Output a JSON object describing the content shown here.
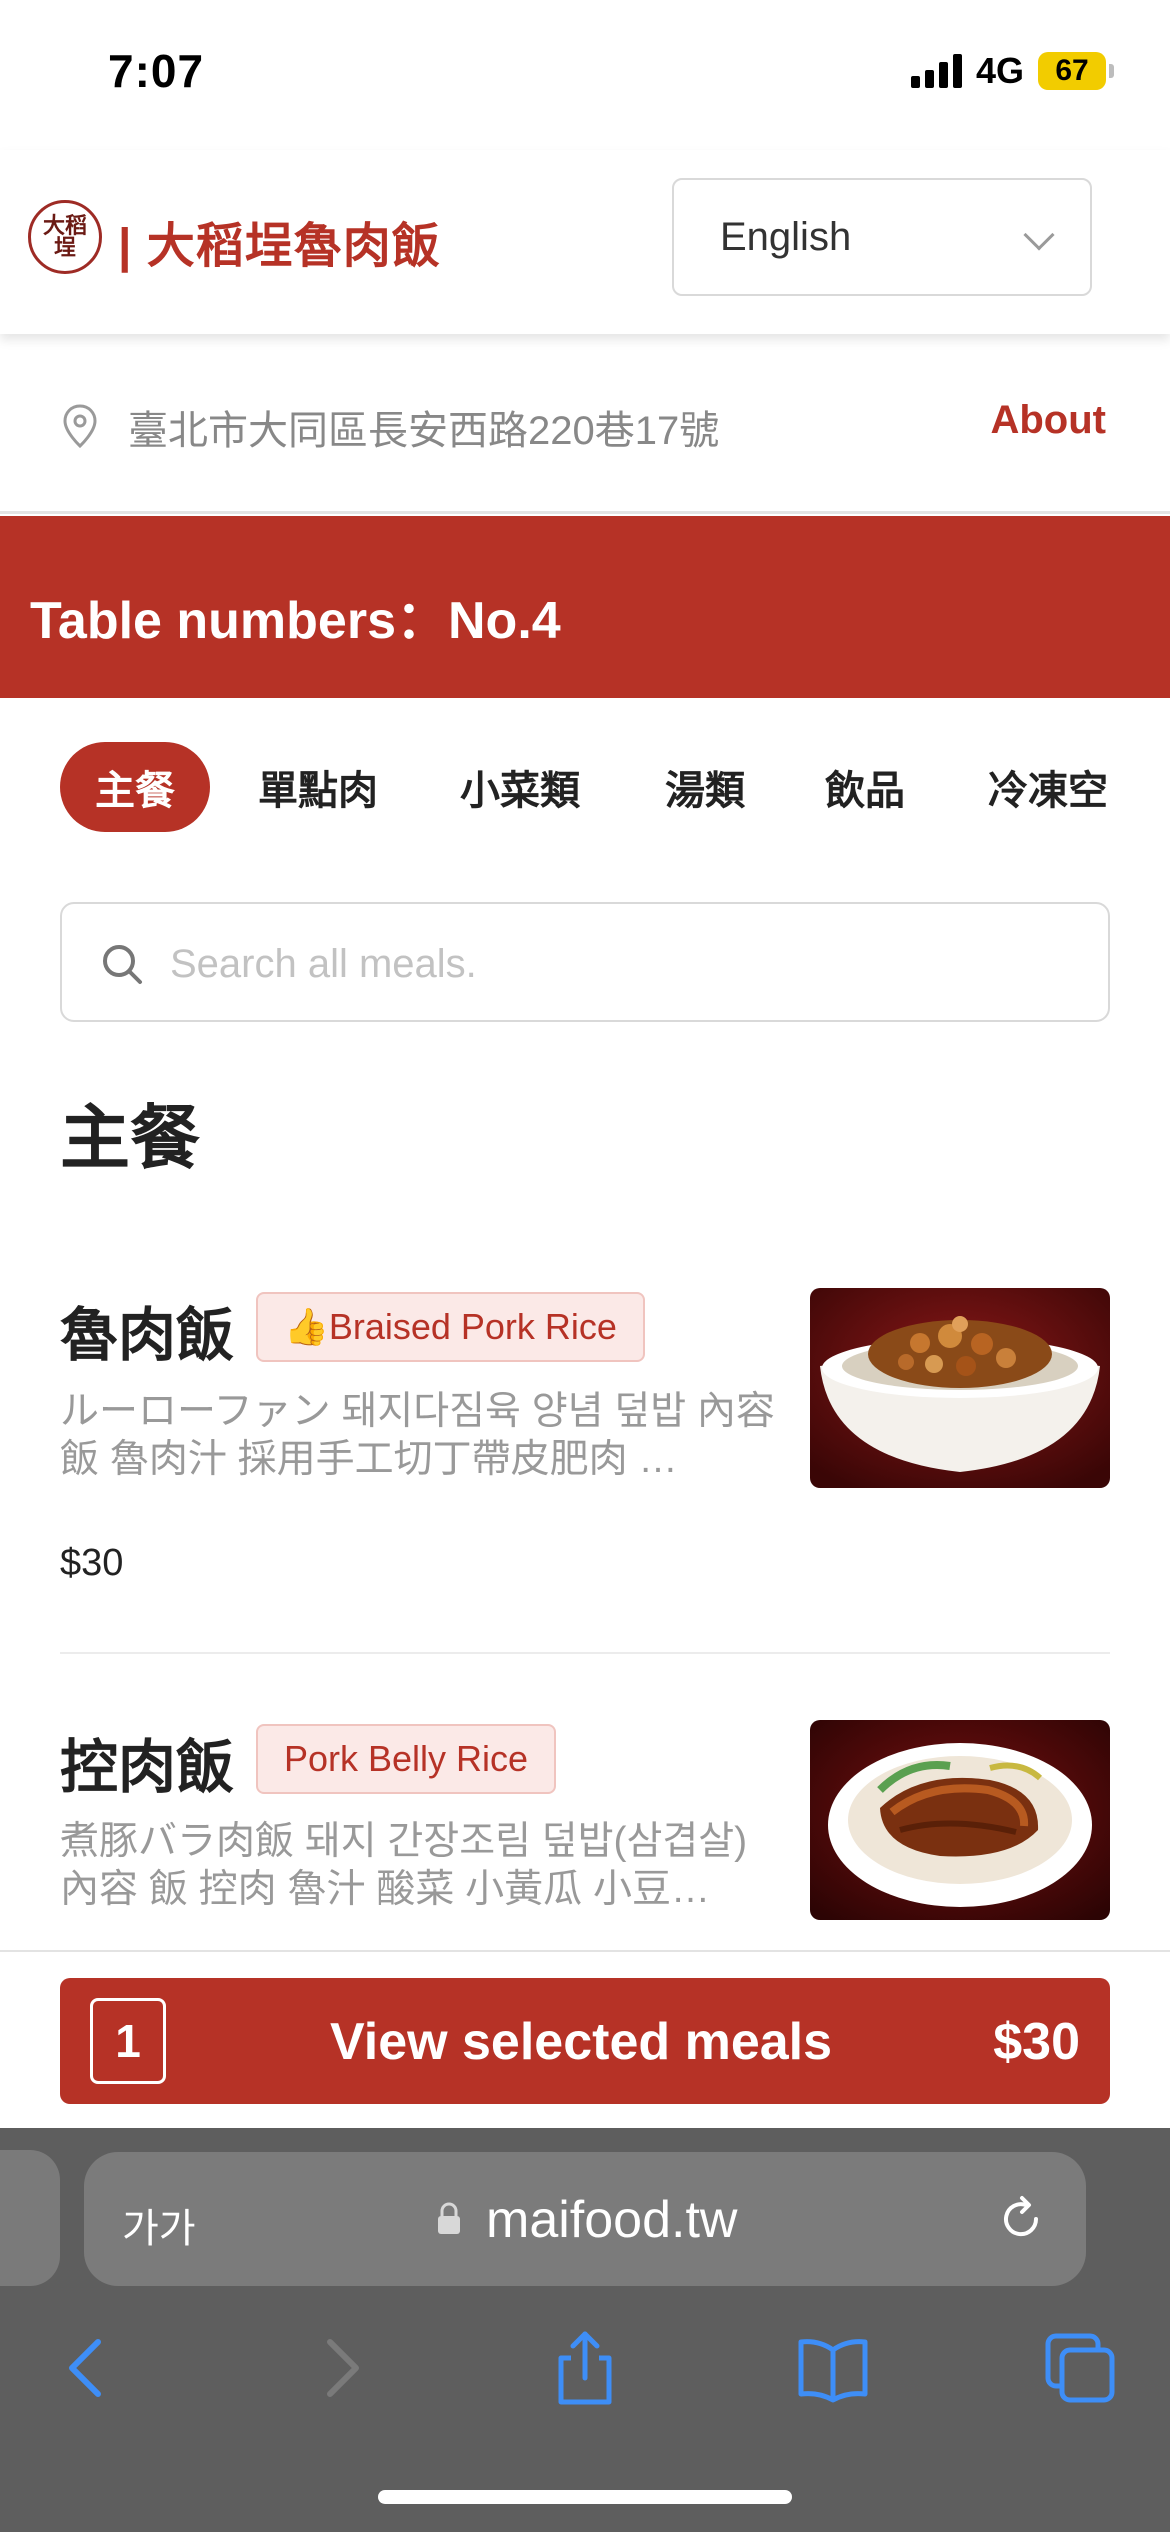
{
  "status_bar": {
    "time": "7:07",
    "network": "4G",
    "battery": "67"
  },
  "header": {
    "brand": "| 大稻埕魯肉飯",
    "logo_text": "大稻埕",
    "language": "English"
  },
  "address_row": {
    "address": "臺北市大同區長安西路220巷17號",
    "about": "About"
  },
  "table_banner": {
    "label": "Table numbers：No.4"
  },
  "tabs": [
    {
      "label": "主餐",
      "active": true
    },
    {
      "label": "單點肉"
    },
    {
      "label": "小菜類"
    },
    {
      "label": "湯類"
    },
    {
      "label": "飲品"
    },
    {
      "label": "冷凍空"
    }
  ],
  "search": {
    "placeholder": "Search all meals."
  },
  "section": {
    "title": "主餐"
  },
  "meals": [
    {
      "name": "魯肉飯",
      "tag": "👍Braised Pork Rice",
      "description": "ルーローファン  돼지다짐육 양념 덮밥  內容 飯 魯肉汁 採用手工切丁帶皮肥肉 …",
      "price": "$30"
    },
    {
      "name": "控肉飯",
      "tag": "Pork Belly Rice",
      "description": "煮豚バラ肉飯  돼지 간장조림 덮밥(삼겹살) 內容 飯 控肉 魯汁 酸菜 小黃瓜 小豆…"
    }
  ],
  "action_bar": {
    "count": "1",
    "label": "View selected meals",
    "total": "$30"
  },
  "safari": {
    "aa": "가가",
    "url": "maifood.tw"
  },
  "colors": {
    "brand_red": "#b63226",
    "tag_bg": "#fbe9e7",
    "ios_blue": "#3e8ef7"
  }
}
